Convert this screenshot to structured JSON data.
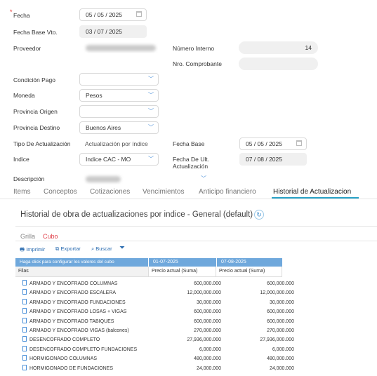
{
  "form": {
    "fecha_label": "Fecha",
    "fecha_value": "05 / 05 / 2025",
    "fecha_base_vto_label": "Fecha Base Vto.",
    "fecha_base_vto_value": "03 / 07 / 2025",
    "proveedor_label": "Proveedor",
    "numero_interno_label": "Número Interno",
    "numero_interno_value": "14",
    "nro_comprobante_label": "Nro. Comprobante",
    "condicion_pago_label": "Condición Pago",
    "moneda_label": "Moneda",
    "moneda_value": "Pesos",
    "provincia_origen_label": "Provincia Origen",
    "provincia_destino_label": "Provincia Destino",
    "provincia_destino_value": "Buenos Aires",
    "tipo_actualizacion_label": "Tipo De Actualización",
    "tipo_actualizacion_value": "Actualización por índice",
    "fecha_base_label": "Fecha Base",
    "fecha_base_value": "05 / 05 / 2025",
    "indice_label": "Indice",
    "indice_value": "Indice CAC - MO",
    "fecha_ult_label": "Fecha De Ult. Actualización",
    "fecha_ult_value": "07 / 08 / 2025",
    "descripcion_label": "Descripción"
  },
  "tabs": [
    "Items",
    "Conceptos",
    "Cotizaciones",
    "Vencimientos",
    "Anticipo financiero",
    "Historial de Actualizacion"
  ],
  "section_title": "Historial de obra de actualizaciones por indice - General (default)",
  "view_tabs": {
    "grilla": "Grilla",
    "cubo": "Cubo"
  },
  "toolbar": {
    "imprimir": "Imprimir",
    "exportar": "Exportar",
    "buscar": "Buscar"
  },
  "cube": {
    "config_hint": "Haga click para configurar los valores del cubo",
    "filas_label": "Filas",
    "col1_date": "01-07-2025",
    "col2_date": "07-08-2025",
    "col1_measure": "Precio actual (Suma)",
    "col2_measure": "Precio actual (Suma)",
    "rows": [
      {
        "name": "ARMADO Y ENCOFRADO COLUMNAS",
        "v1": "600,000.000",
        "v2": "600,000.000"
      },
      {
        "name": "ARMADO Y ENCOFRADO ESCALERA",
        "v1": "12,000,000.000",
        "v2": "12,000,000.000"
      },
      {
        "name": "ARMADO Y ENCOFRADO FUNDACIONES",
        "v1": "30,000.000",
        "v2": "30,000.000"
      },
      {
        "name": "ARMADO Y ENCOFRADO LOSAS + VIGAS",
        "v1": "600,000.000",
        "v2": "600,000.000"
      },
      {
        "name": "ARMADO Y ENCOFRADO TABIQUES",
        "v1": "600,000.000",
        "v2": "600,000.000"
      },
      {
        "name": "ARMADO Y ENCOFRADO VIGAS (balcones)",
        "v1": "270,000.000",
        "v2": "270,000.000"
      },
      {
        "name": "DESENCOFRADO COMPLETO",
        "v1": "27,936,000.000",
        "v2": "27,936,000.000"
      },
      {
        "name": "DESENCOFRADO COMPLETO FUNDACIONES",
        "v1": "6,000.000",
        "v2": "6,000.000"
      },
      {
        "name": "HORMIGONADO COLUMNAS",
        "v1": "480,000.000",
        "v2": "480,000.000"
      },
      {
        "name": "HORMIGONADO DE FUNDACIONES",
        "v1": "24,000.000",
        "v2": "24,000.000"
      }
    ]
  },
  "colors": {
    "accent": "#29a3c7",
    "cube_header": "#6fa8dc",
    "required": "#e53935"
  }
}
